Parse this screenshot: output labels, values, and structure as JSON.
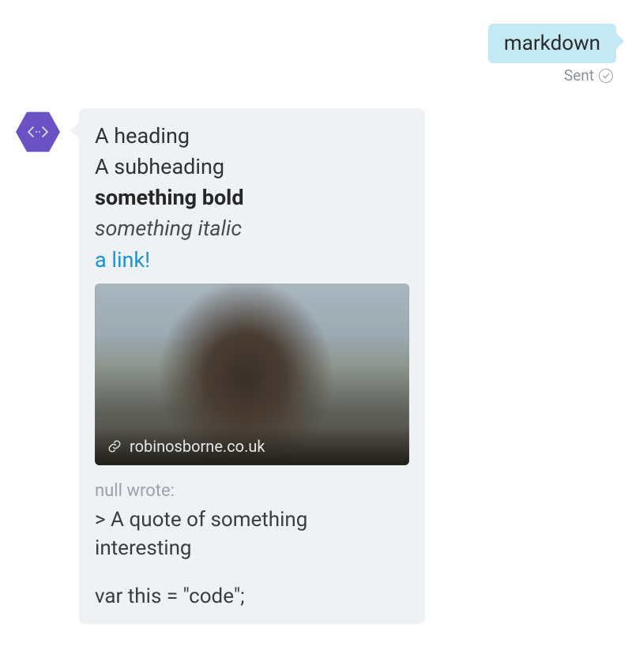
{
  "user_message": {
    "text": "markdown",
    "status_label": "Sent"
  },
  "bot_message": {
    "heading": "A heading",
    "subheading": "A subheading",
    "bold_text": "something bold",
    "italic_text": "something italic",
    "link_text": "a link!",
    "card": {
      "source": "robinosborne.co.uk"
    },
    "quote": {
      "author_line": "null wrote:",
      "body": "> A quote of something interesting"
    },
    "code": "var this = \"code\";"
  },
  "icons": {
    "bot_avatar": "code-hexagon-icon",
    "sent_check": "check-circle-icon",
    "link_card": "link-icon"
  }
}
